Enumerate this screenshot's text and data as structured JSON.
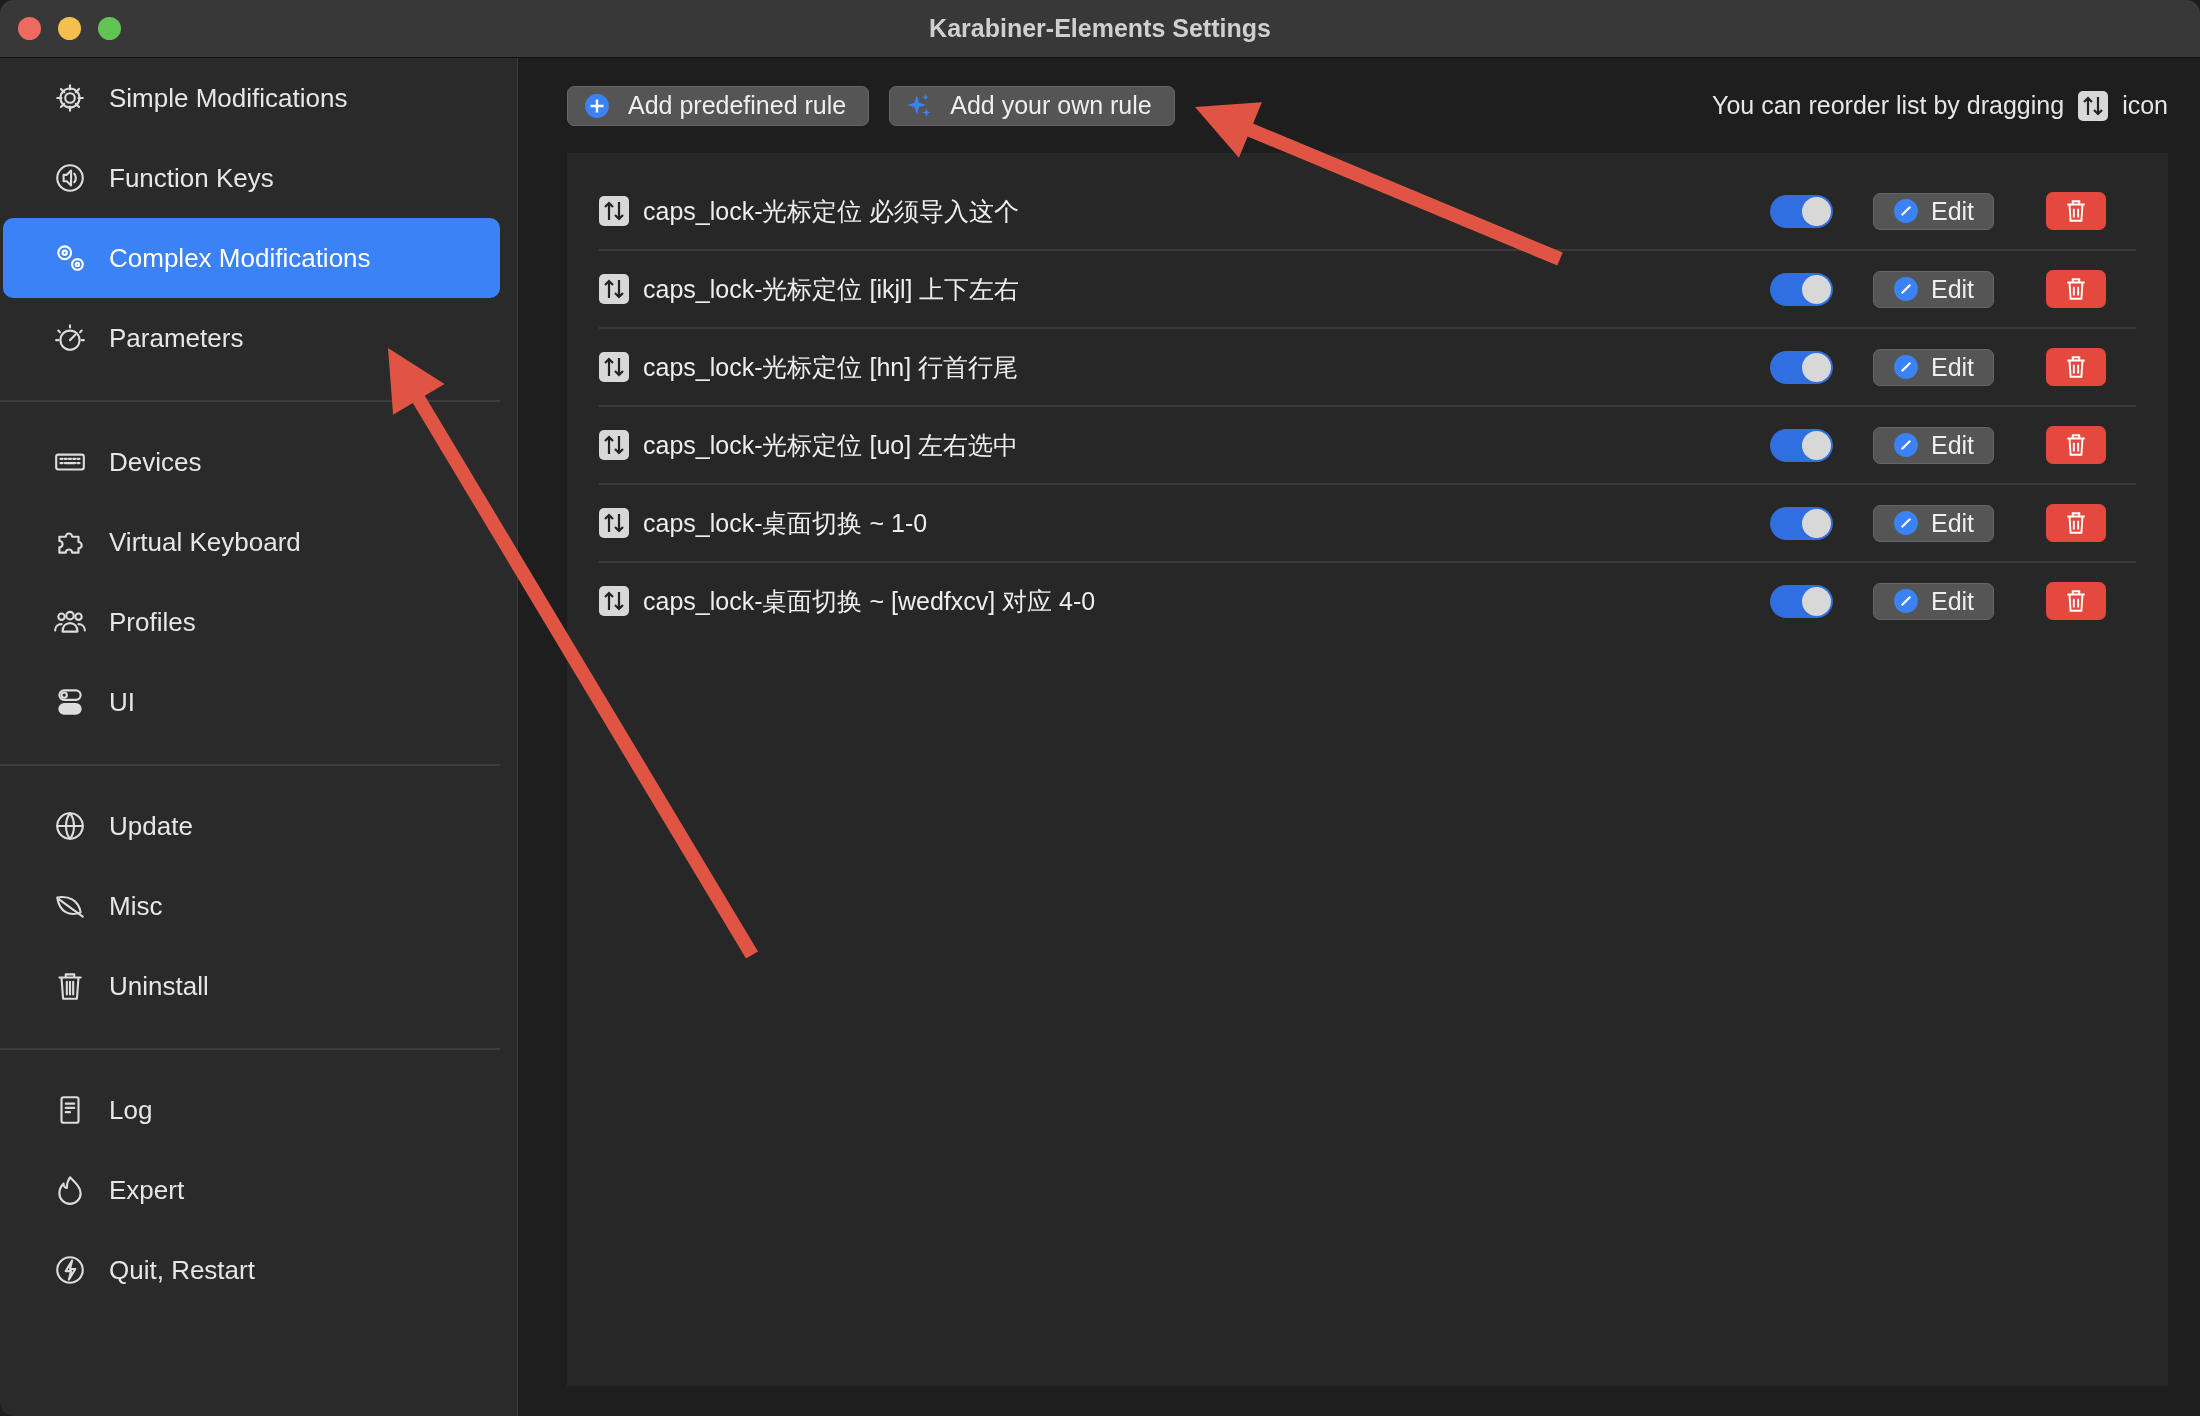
{
  "window": {
    "title": "Karabiner-Elements Settings"
  },
  "sidebar": {
    "groups": [
      {
        "items": [
          {
            "label": "Simple Modifications",
            "selected": false
          },
          {
            "label": "Function Keys",
            "selected": false
          },
          {
            "label": "Complex Modifications",
            "selected": true
          },
          {
            "label": "Parameters",
            "selected": false
          }
        ]
      },
      {
        "items": [
          {
            "label": "Devices",
            "selected": false
          },
          {
            "label": "Virtual Keyboard",
            "selected": false
          },
          {
            "label": "Profiles",
            "selected": false
          },
          {
            "label": "UI",
            "selected": false
          }
        ]
      },
      {
        "items": [
          {
            "label": "Update",
            "selected": false
          },
          {
            "label": "Misc",
            "selected": false
          },
          {
            "label": "Uninstall",
            "selected": false
          }
        ]
      },
      {
        "items": [
          {
            "label": "Log",
            "selected": false
          },
          {
            "label": "Expert",
            "selected": false
          },
          {
            "label": "Quit, Restart",
            "selected": false
          }
        ]
      }
    ]
  },
  "toolbar": {
    "buttons": [
      "Add predefined rule",
      "Add your own rule"
    ],
    "hint": "You can reorder list by dragging",
    "hint_suffix": "icon"
  },
  "rules": [
    {
      "name": "caps_lock-光标定位 必须导入这个",
      "on": true,
      "edit": "Edit"
    },
    {
      "name": "caps_lock-光标定位 [ikjl] 上下左右",
      "on": true,
      "edit": "Edit"
    },
    {
      "name": "caps_lock-光标定位 [hn] 行首行尾",
      "on": true,
      "edit": "Edit"
    },
    {
      "name": "caps_lock-光标定位 [uo] 左右选中",
      "on": true,
      "edit": "Edit"
    },
    {
      "name": "caps_lock-桌面切换 ~ 1-0",
      "on": true,
      "edit": "Edit"
    },
    {
      "name": "caps_lock-桌面切换 ~ [wedfxcv] 对应 4-0",
      "on": true,
      "edit": "Edit"
    }
  ]
}
